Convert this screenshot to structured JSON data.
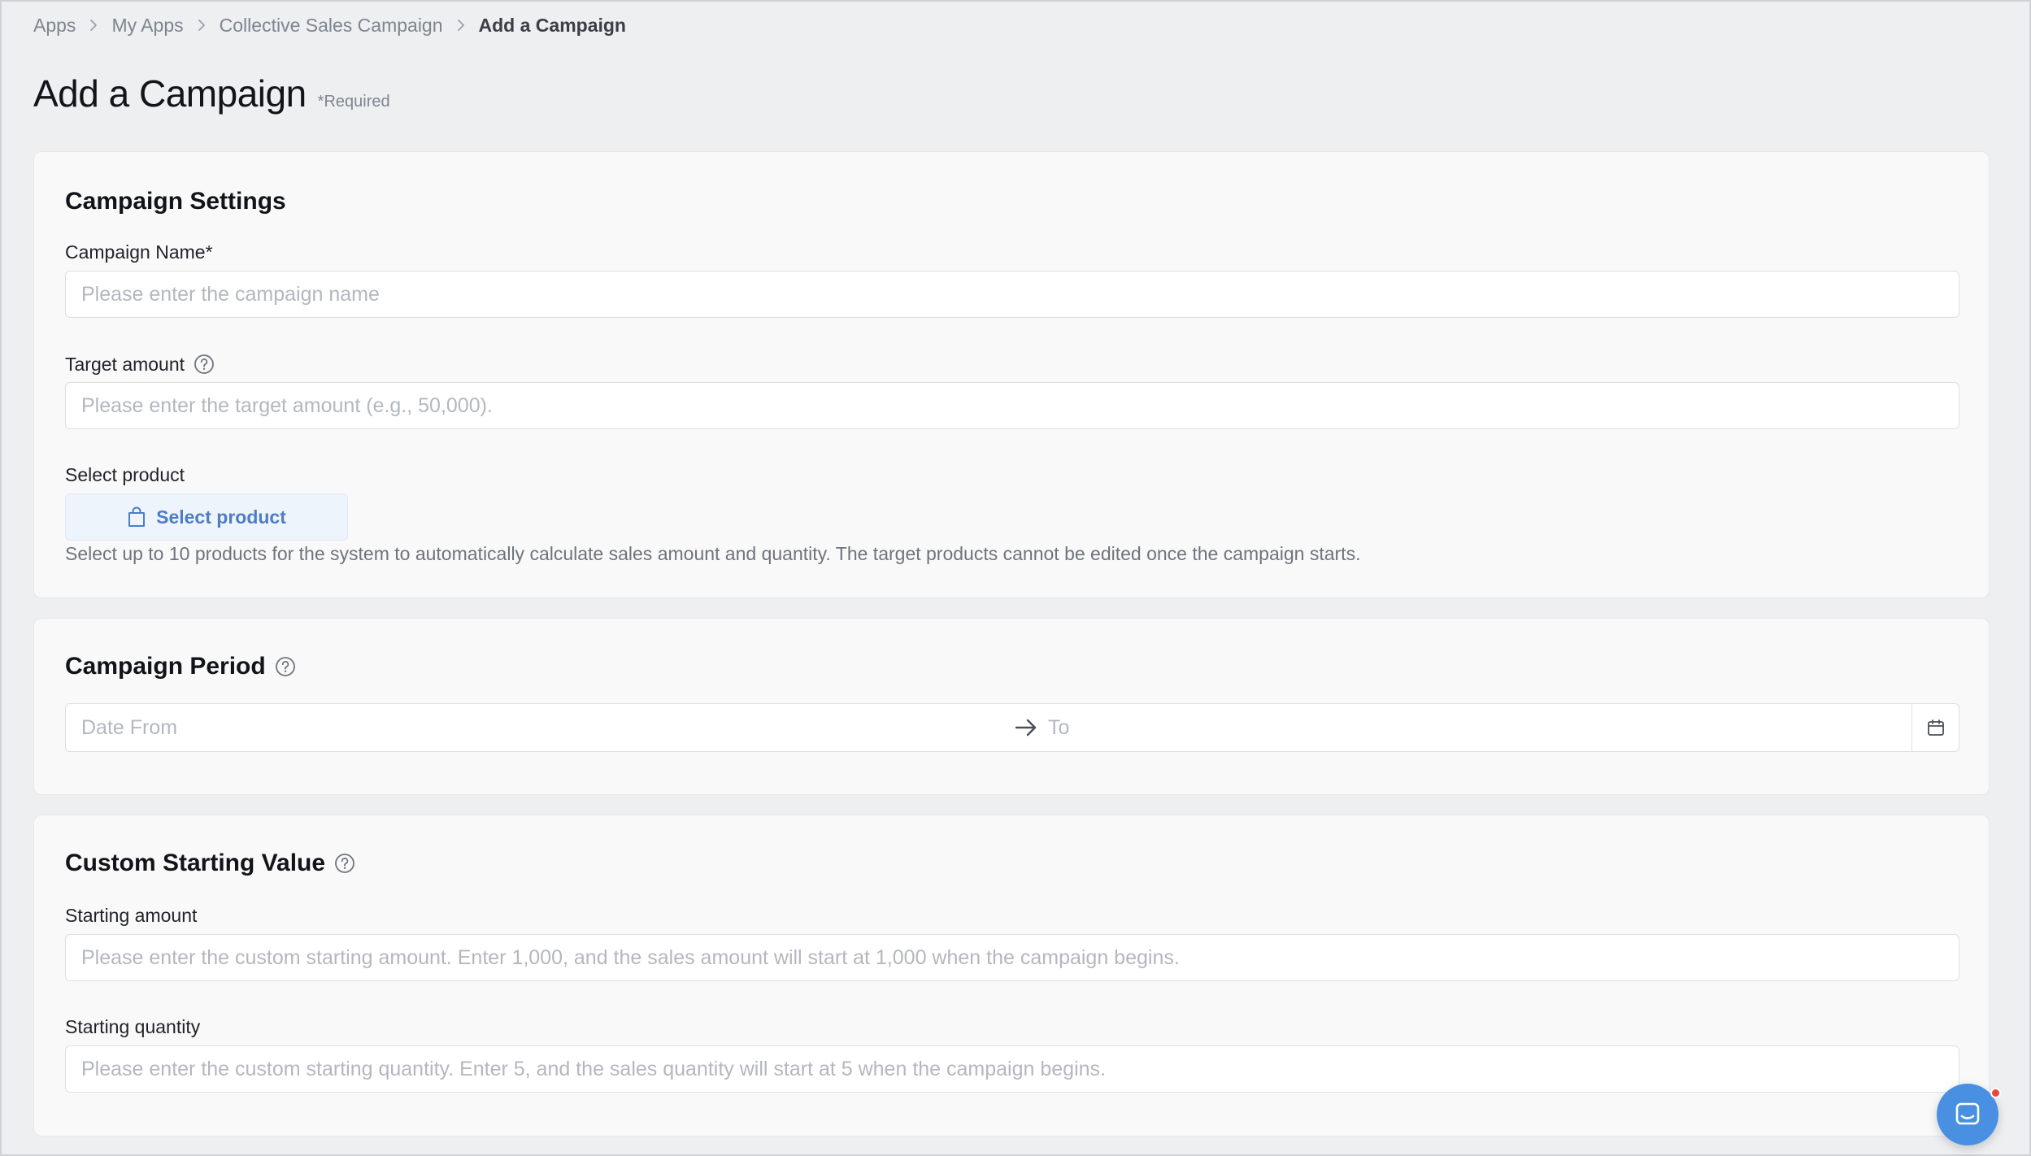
{
  "breadcrumb": {
    "items": [
      "Apps",
      "My Apps",
      "Collective Sales Campaign"
    ],
    "current": "Add a Campaign"
  },
  "page": {
    "title": "Add a Campaign",
    "required_note": "*Required"
  },
  "campaign_settings": {
    "title": "Campaign Settings",
    "name_label": "Campaign Name*",
    "name_placeholder": "Please enter the campaign name",
    "name_value": "",
    "target_label": "Target amount",
    "target_placeholder": "Please enter the target amount (e.g., 50,000).",
    "target_value": "",
    "product_label": "Select product",
    "product_button": "Select product",
    "product_helper": "Select up to 10 products for the system to automatically calculate sales amount and quantity. The target products cannot be edited once the campaign starts."
  },
  "campaign_period": {
    "title": "Campaign Period",
    "from_placeholder": "Date From",
    "to_placeholder": "To"
  },
  "custom_starting": {
    "title": "Custom Starting Value",
    "amount_label": "Starting amount",
    "amount_placeholder": "Please enter the custom starting amount. Enter 1,000, and the sales amount will start at 1,000 when the campaign begins.",
    "quantity_label": "Starting quantity",
    "quantity_placeholder": "Please enter the custom starting quantity. Enter 5, and the sales quantity will start at 5 when the campaign begins."
  },
  "icons": {
    "help": "help-circle-icon",
    "bag": "shopping-bag-icon",
    "arrow": "arrow-right-icon",
    "calendar": "calendar-icon",
    "chat": "chat-icon"
  },
  "colors": {
    "accent": "#4f7cc6",
    "chat_button": "#4a90e2",
    "notification_dot": "#f04438"
  }
}
